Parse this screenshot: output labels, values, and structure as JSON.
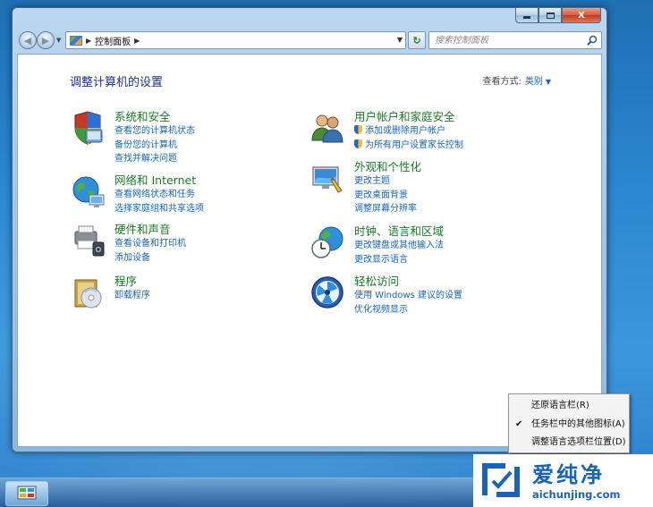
{
  "window": {
    "caption": {
      "close_label": "X"
    },
    "address": {
      "path": "控制面板"
    },
    "search": {
      "placeholder": "搜索控制面板"
    }
  },
  "header": {
    "title": "调整计算机的设置",
    "view_by_label": "查看方式:",
    "view_by_value": "类别"
  },
  "categories": [
    {
      "title": "系统和安全",
      "icon": "system-security-icon",
      "links": [
        "查看您的计算机状态",
        "备份您的计算机",
        "查找并解决问题"
      ]
    },
    {
      "title": "网络和 Internet",
      "icon": "network-icon",
      "links": [
        "查看网络状态和任务",
        "选择家庭组和共享选项"
      ]
    },
    {
      "title": "硬件和声音",
      "icon": "hardware-sound-icon",
      "links": [
        "查看设备和打印机",
        "添加设备"
      ]
    },
    {
      "title": "程序",
      "icon": "programs-icon",
      "links": [
        "卸载程序"
      ]
    },
    {
      "title": "用户帐户和家庭安全",
      "icon": "user-accounts-icon",
      "links": [
        "添加或删除用户帐户",
        "为所有用户设置家长控制"
      ]
    },
    {
      "title": "外观和个性化",
      "icon": "appearance-icon",
      "links": [
        "更改主题",
        "更改桌面背景",
        "调整屏幕分辨率"
      ]
    },
    {
      "title": "时钟、语言和区域",
      "icon": "clock-language-region-icon",
      "links": [
        "更改键盘或其他输入法",
        "更改显示语言"
      ]
    },
    {
      "title": "轻松访问",
      "icon": "ease-of-access-icon",
      "links": [
        "使用 Windows 建议的设置",
        "优化视频显示"
      ]
    }
  ],
  "context_menu": {
    "items": [
      {
        "label": "还原语言栏(R)",
        "checked": false
      },
      {
        "label": "任务栏中的其他图标(A)",
        "checked": true
      },
      {
        "label": "调整语言选项栏位置(D)",
        "checked": false
      }
    ]
  },
  "watermark": {
    "main": "爱纯净",
    "sub": "aichunjing.com"
  },
  "colors": {
    "link": "#1866b4",
    "category_title": "#1a7a28",
    "page_title": "#1e3287",
    "watermark": "#1b63b3"
  }
}
